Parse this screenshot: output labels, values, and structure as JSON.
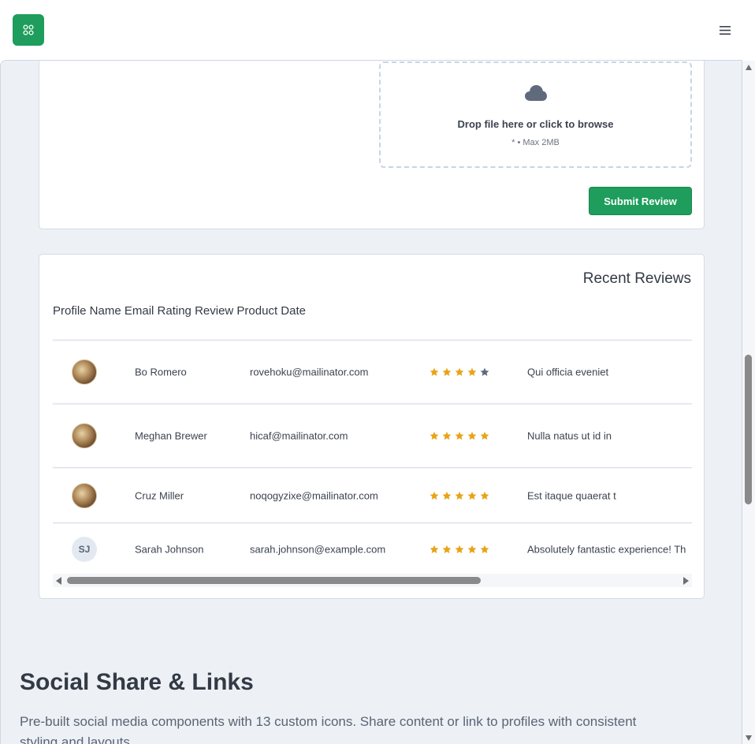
{
  "header": {
    "logo_icon": "app-grid-icon",
    "menu_icon": "hamburger-menu-icon",
    "brand_color": "#1f9d5c"
  },
  "upload": {
    "icon": "cloud-icon",
    "title": "Drop file here or click to browse",
    "subtitle": "* • Max 2MB"
  },
  "submit_label": "Submit Review",
  "reviews": {
    "title": "Recent Reviews",
    "columns_text": "Profile Name Email Rating Review Product Date",
    "rows": [
      {
        "avatar": "photo",
        "initials": "",
        "name": "Bo Romero",
        "email": "rovehoku@mailinator.com",
        "rating": 4,
        "review": "Qui officia eveniet"
      },
      {
        "avatar": "photo",
        "initials": "",
        "name": "Meghan Brewer",
        "email": "hicaf@mailinator.com",
        "rating": 5,
        "review": "Nulla natus ut id in"
      },
      {
        "avatar": "photo",
        "initials": "",
        "name": "Cruz Miller",
        "email": "noqogyzixe@mailinator.com",
        "rating": 5,
        "review": "Est itaque quaerat t"
      },
      {
        "avatar": "initials",
        "initials": "SJ",
        "name": "Sarah Johnson",
        "email": "sarah.johnson@example.com",
        "rating": 5,
        "review": "Absolutely fantastic experience! Th"
      }
    ],
    "star_color": "#e8a317",
    "star_empty_color": "#5b6b80"
  },
  "social": {
    "title": "Social Share & Links",
    "description": "Pre-built social media components with 13 custom icons. Share content or link to profiles with consistent styling and layouts."
  }
}
